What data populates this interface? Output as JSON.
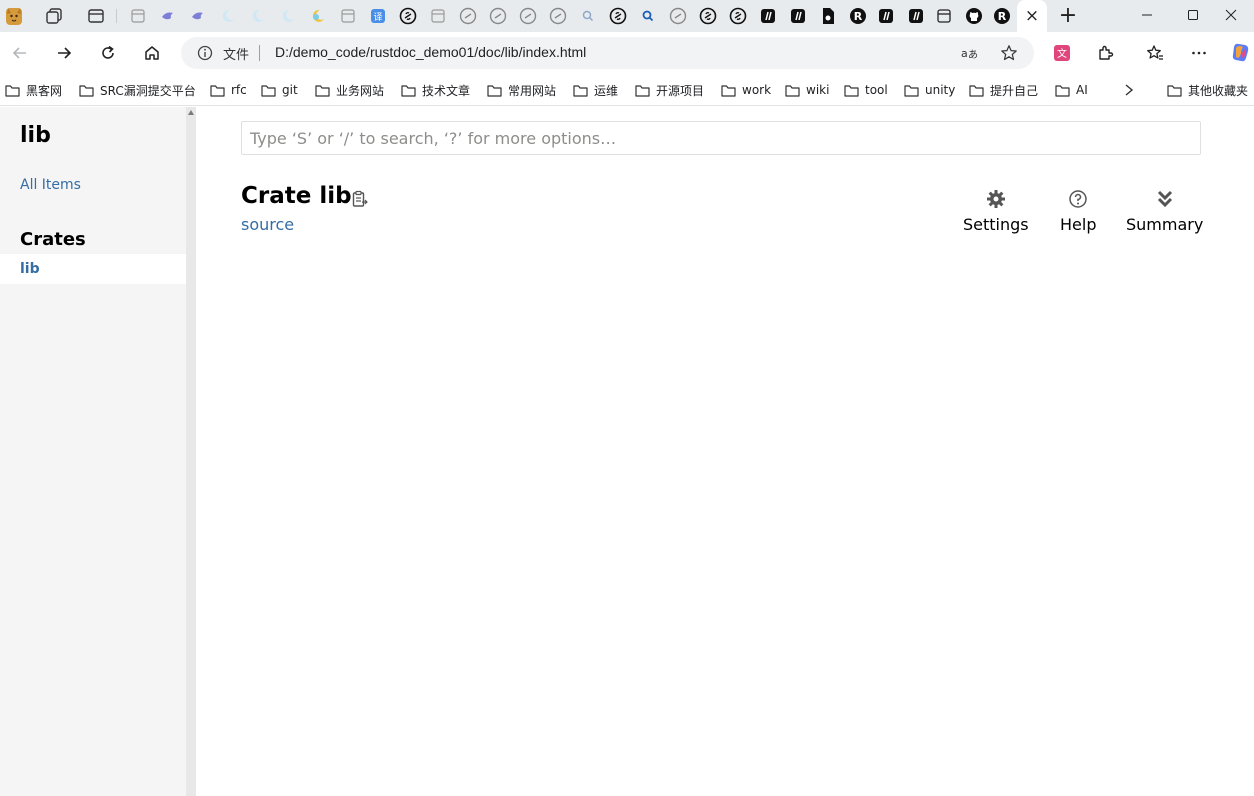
{
  "browser": {
    "tab_close_glyph": "×",
    "new_tab_glyph": "+",
    "address_bar": {
      "scheme_label": "文件",
      "url": "D:/demo_code/rustdoc_demo01/doc/lib/index.html"
    },
    "bookmarks": [
      {
        "label": "黑客网"
      },
      {
        "label": "SRC漏洞提交平台"
      },
      {
        "label": "rfc"
      },
      {
        "label": "git"
      },
      {
        "label": "业务网站"
      },
      {
        "label": "技术文章"
      },
      {
        "label": "常用网站"
      },
      {
        "label": "运维"
      },
      {
        "label": "开源项目"
      },
      {
        "label": "work"
      },
      {
        "label": "wiki"
      },
      {
        "label": "tool"
      },
      {
        "label": "unity"
      },
      {
        "label": "提升自己"
      },
      {
        "label": "AI"
      }
    ],
    "other_bookmarks_label": "其他收藏夹"
  },
  "sidebar": {
    "crate_name": "lib",
    "all_items_label": "All Items",
    "crates_heading": "Crates",
    "crates": [
      {
        "label": "lib"
      }
    ]
  },
  "main": {
    "search_placeholder": "Type ‘S’ or ‘/’ to search, ‘?’ for more options…",
    "title": "Crate lib",
    "source_label": "source",
    "toolbar": {
      "settings_label": "Settings",
      "help_label": "Help",
      "summary_label": "Summary"
    }
  },
  "colors": {
    "link": "#356da4",
    "sidebar_bg": "#f5f5f5",
    "tabstrip_bg": "#e8ebee"
  }
}
